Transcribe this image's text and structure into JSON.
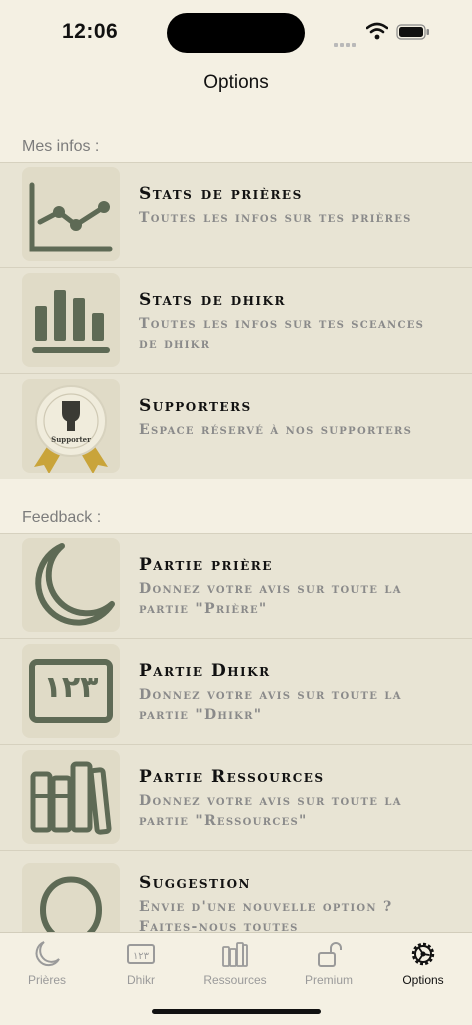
{
  "status_bar": {
    "time": "12:06"
  },
  "header": {
    "title": "Options"
  },
  "sections": {
    "mes_infos": {
      "label": "Mes infos :",
      "items": [
        {
          "title": "Stats de prières",
          "subtitle": "Toutes les infos sur tes prières",
          "icon": "line-chart-icon"
        },
        {
          "title": "Stats de dhikr",
          "subtitle": "Toutes les infos sur tes sceances de dhikr",
          "icon": "bar-chart-icon"
        },
        {
          "title": "Supporters",
          "subtitle": "Espace réservé à nos supporters",
          "icon": "supporter-seal-icon",
          "badge_text": "Supporter"
        }
      ]
    },
    "feedback": {
      "label": "Feedback :",
      "items": [
        {
          "title": "Partie prière",
          "subtitle": "Donnez votre avis sur toute la partie \"Prière\"",
          "icon": "crescent-moon-icon"
        },
        {
          "title": "Partie Dhikr",
          "subtitle": "Donnez votre avis sur toute la partie \"Dhikr\"",
          "icon": "counter-icon",
          "icon_text": "١٢٣"
        },
        {
          "title": "Partie Ressources",
          "subtitle": "Donnez votre avis sur toute la partie \"Ressources\"",
          "icon": "books-icon"
        },
        {
          "title": "Suggestion",
          "subtitle": "Envie d'une nouvelle option ? Faites-nous toutes",
          "icon": "lightbulb-icon"
        }
      ]
    }
  },
  "tab_bar": {
    "tabs": [
      {
        "label": "Prières",
        "icon": "crescent-moon-icon",
        "active": false
      },
      {
        "label": "Dhikr",
        "icon": "counter-icon",
        "icon_text": "١٢٣",
        "active": false
      },
      {
        "label": "Ressources",
        "icon": "books-icon",
        "active": false
      },
      {
        "label": "Premium",
        "icon": "unlock-icon",
        "active": false
      },
      {
        "label": "Options",
        "icon": "gear-icon",
        "active": true
      }
    ]
  },
  "colors": {
    "background": "#f4f0e3",
    "row_background": "#e8e4d4",
    "icon_box": "#e0dbc7",
    "icon_green": "#5e6a55",
    "title_text": "#111111",
    "subtitle_text": "#8a8a8a",
    "section_header": "#7c7c7c",
    "ribbon_gold": "#c9a43a"
  }
}
